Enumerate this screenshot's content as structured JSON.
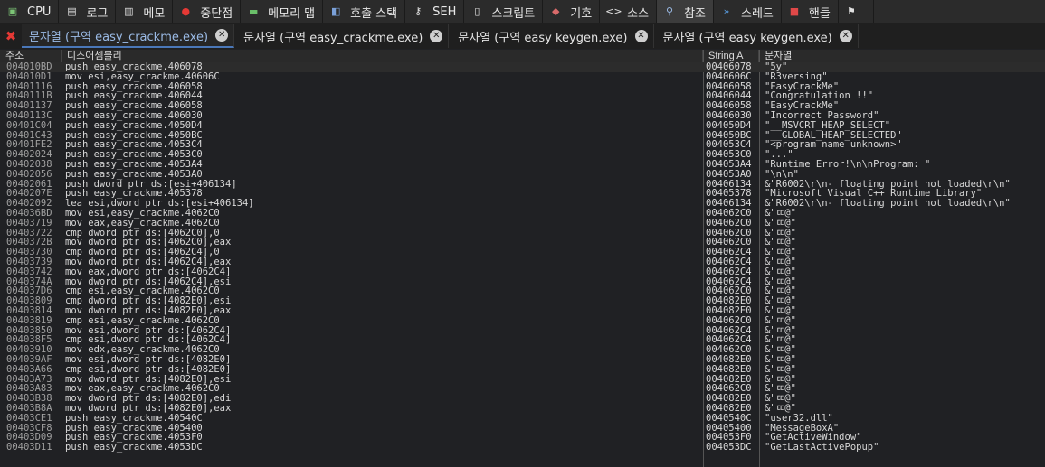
{
  "top_tabs": [
    {
      "label": "CPU",
      "icon": "cpu-icon",
      "active": false
    },
    {
      "label": "로그",
      "icon": "log-icon",
      "active": false
    },
    {
      "label": "메모",
      "icon": "notes-icon",
      "active": false
    },
    {
      "label": "중단점",
      "icon": "breakpoint-icon",
      "active": false
    },
    {
      "label": "메모리 맵",
      "icon": "memory-map-icon",
      "active": false
    },
    {
      "label": "호출 스택",
      "icon": "call-stack-icon",
      "active": false
    },
    {
      "label": "SEH",
      "icon": "seh-icon",
      "active": false
    },
    {
      "label": "스크립트",
      "icon": "script-icon",
      "active": false
    },
    {
      "label": "기호",
      "icon": "symbols-icon",
      "active": false
    },
    {
      "label": "소스",
      "icon": "source-icon",
      "active": false
    },
    {
      "label": "참조",
      "icon": "references-icon",
      "active": true
    },
    {
      "label": "스레드",
      "icon": "threads-icon",
      "active": false
    },
    {
      "label": "핸들",
      "icon": "handles-icon",
      "active": false
    },
    {
      "label": "",
      "icon": "trace-icon",
      "active": false
    }
  ],
  "sub_tabs": [
    {
      "label": "문자열 (구역 easy_crackme.exe)",
      "active": true
    },
    {
      "label": "문자열 (구역 easy_crackme.exe)",
      "active": false
    },
    {
      "label": "문자열 (구역 easy keygen.exe)",
      "active": false
    },
    {
      "label": "문자열 (구역 easy keygen.exe)",
      "active": false
    }
  ],
  "columns": {
    "address": "주소",
    "disasm": "디스어셈블리",
    "string_addr": "String A",
    "string": "문자열"
  },
  "rows": [
    {
      "addr": "004010BD",
      "dis": "push easy_crackme.406078",
      "sa": "00406078",
      "str": "\"5y\""
    },
    {
      "addr": "004010D1",
      "dis": "mov esi,easy_crackme.40606C",
      "sa": "0040606C",
      "str": "\"R3versing\""
    },
    {
      "addr": "00401116",
      "dis": "push easy_crackme.406058",
      "sa": "00406058",
      "str": "\"EasyCrackMe\""
    },
    {
      "addr": "0040111B",
      "dis": "push easy_crackme.406044",
      "sa": "00406044",
      "str": "\"Congratulation !!\""
    },
    {
      "addr": "00401137",
      "dis": "push easy_crackme.406058",
      "sa": "00406058",
      "str": "\"EasyCrackMe\""
    },
    {
      "addr": "0040113C",
      "dis": "push easy_crackme.406030",
      "sa": "00406030",
      "str": "\"Incorrect Password\""
    },
    {
      "addr": "00401C04",
      "dis": "push easy_crackme.4050D4",
      "sa": "004050D4",
      "str": "\"__MSVCRT_HEAP_SELECT\""
    },
    {
      "addr": "00401C43",
      "dis": "push easy_crackme.4050BC",
      "sa": "004050BC",
      "str": "\"__GLOBAL_HEAP_SELECTED\""
    },
    {
      "addr": "00401FE2",
      "dis": "push easy_crackme.4053C4",
      "sa": "004053C4",
      "str": "\"<program name unknown>\""
    },
    {
      "addr": "00402024",
      "dis": "push easy_crackme.4053C0",
      "sa": "004053C0",
      "str": "\"...\""
    },
    {
      "addr": "00402038",
      "dis": "push easy_crackme.4053A4",
      "sa": "004053A4",
      "str": "\"Runtime Error!\\n\\nProgram: \""
    },
    {
      "addr": "00402056",
      "dis": "push easy_crackme.4053A0",
      "sa": "004053A0",
      "str": "\"\\n\\n\""
    },
    {
      "addr": "00402061",
      "dis": "push dword ptr ds:[esi+406134]",
      "sa": "00406134",
      "str": "&\"R6002\\r\\n- floating point not loaded\\r\\n\""
    },
    {
      "addr": "0040207E",
      "dis": "push easy_crackme.405378",
      "sa": "00405378",
      "str": "\"Microsoft Visual C++ Runtime Library\""
    },
    {
      "addr": "00402092",
      "dis": "lea esi,dword ptr ds:[esi+406134]",
      "sa": "00406134",
      "str": "&\"R6002\\r\\n- floating point not loaded\\r\\n\""
    },
    {
      "addr": "004036BD",
      "dis": "mov esi,easy_crackme.4062C0",
      "sa": "004062C0",
      "str": "&\"ㄸ@\""
    },
    {
      "addr": "00403719",
      "dis": "mov eax,easy_crackme.4062C0",
      "sa": "004062C0",
      "str": "&\"ㄸ@\""
    },
    {
      "addr": "00403722",
      "dis": "cmp dword ptr ds:[4062C0],0",
      "sa": "004062C0",
      "str": "&\"ㄸ@\""
    },
    {
      "addr": "0040372B",
      "dis": "mov dword ptr ds:[4062C0],eax",
      "sa": "004062C0",
      "str": "&\"ㄸ@\""
    },
    {
      "addr": "00403730",
      "dis": "cmp dword ptr ds:[4062C4],0",
      "sa": "004062C4",
      "str": "&\"ㄸ@\""
    },
    {
      "addr": "00403739",
      "dis": "mov dword ptr ds:[4062C4],eax",
      "sa": "004062C4",
      "str": "&\"ㄸ@\""
    },
    {
      "addr": "00403742",
      "dis": "mov eax,dword ptr ds:[4062C4]",
      "sa": "004062C4",
      "str": "&\"ㄸ@\""
    },
    {
      "addr": "0040374A",
      "dis": "mov dword ptr ds:[4062C4],esi",
      "sa": "004062C4",
      "str": "&\"ㄸ@\""
    },
    {
      "addr": "004037D6",
      "dis": "cmp esi,easy_crackme.4062C0",
      "sa": "004062C0",
      "str": "&\"ㄸ@\""
    },
    {
      "addr": "00403809",
      "dis": "cmp dword ptr ds:[4082E0],esi",
      "sa": "004082E0",
      "str": "&\"ㄸ@\""
    },
    {
      "addr": "00403814",
      "dis": "mov dword ptr ds:[4082E0],eax",
      "sa": "004082E0",
      "str": "&\"ㄸ@\""
    },
    {
      "addr": "00403819",
      "dis": "cmp esi,easy_crackme.4062C0",
      "sa": "004062C0",
      "str": "&\"ㄸ@\""
    },
    {
      "addr": "00403850",
      "dis": "mov esi,dword ptr ds:[4062C4]",
      "sa": "004062C4",
      "str": "&\"ㄸ@\""
    },
    {
      "addr": "004038F5",
      "dis": "cmp esi,dword ptr ds:[4062C4]",
      "sa": "004062C4",
      "str": "&\"ㄸ@\""
    },
    {
      "addr": "00403910",
      "dis": "mov edx,easy_crackme.4062C0",
      "sa": "004062C0",
      "str": "&\"ㄸ@\""
    },
    {
      "addr": "004039AF",
      "dis": "mov esi,dword ptr ds:[4082E0]",
      "sa": "004082E0",
      "str": "&\"ㄸ@\""
    },
    {
      "addr": "00403A66",
      "dis": "cmp esi,dword ptr ds:[4082E0]",
      "sa": "004082E0",
      "str": "&\"ㄸ@\""
    },
    {
      "addr": "00403A73",
      "dis": "mov dword ptr ds:[4082E0],esi",
      "sa": "004082E0",
      "str": "&\"ㄸ@\""
    },
    {
      "addr": "00403A83",
      "dis": "mov eax,easy_crackme.4062C0",
      "sa": "004062C0",
      "str": "&\"ㄸ@\""
    },
    {
      "addr": "00403B38",
      "dis": "mov dword ptr ds:[4082E0],edi",
      "sa": "004082E0",
      "str": "&\"ㄸ@\""
    },
    {
      "addr": "00403B8A",
      "dis": "mov dword ptr ds:[4082E0],eax",
      "sa": "004082E0",
      "str": "&\"ㄸ@\""
    },
    {
      "addr": "00403CE1",
      "dis": "push easy_crackme.40540C",
      "sa": "0040540C",
      "str": "\"user32.dll\""
    },
    {
      "addr": "00403CF8",
      "dis": "push easy_crackme.405400",
      "sa": "00405400",
      "str": "\"MessageBoxA\""
    },
    {
      "addr": "00403D09",
      "dis": "push easy_crackme.4053F0",
      "sa": "004053F0",
      "str": "\"GetActiveWindow\""
    },
    {
      "addr": "00403D11",
      "dis": "push easy_crackme.4053DC",
      "sa": "004053DC",
      "str": "\"GetLastActivePopup\""
    }
  ],
  "selected_row": 0,
  "colors": {
    "accent": "#9bbbe6",
    "close_all": "#e53935"
  }
}
